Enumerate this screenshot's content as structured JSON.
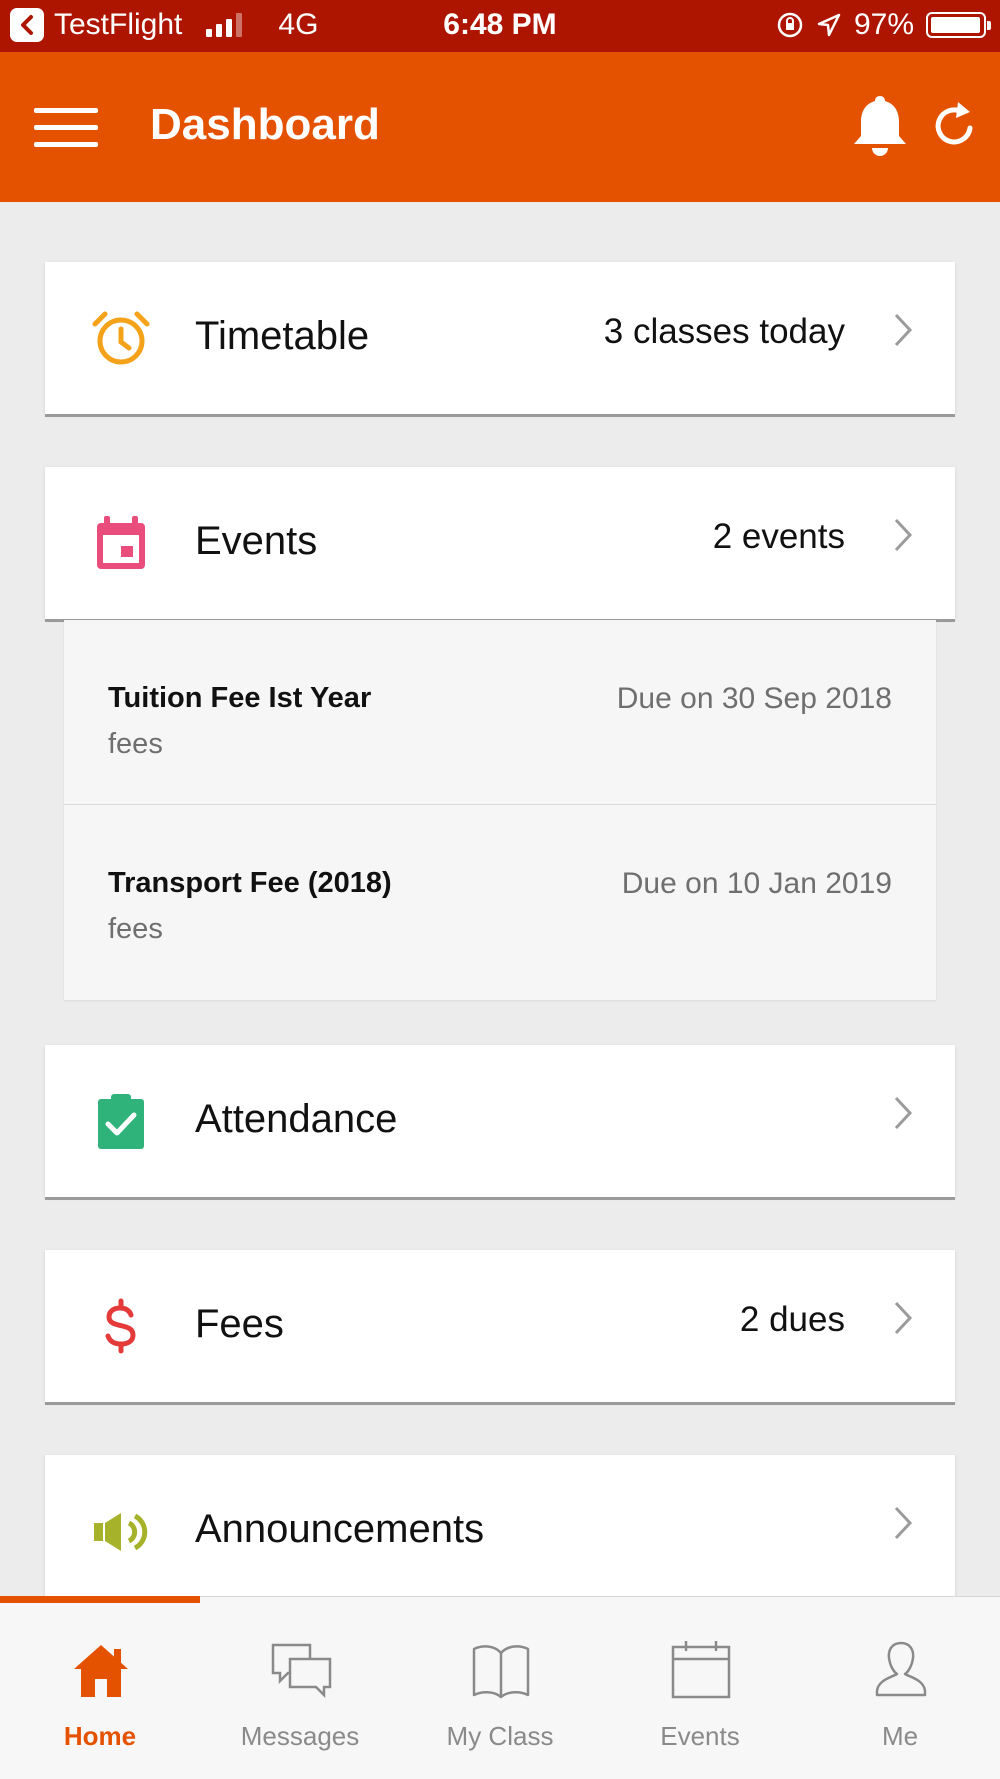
{
  "status_bar": {
    "back_app": "TestFlight",
    "network": "4G",
    "time": "6:48 PM",
    "battery": "97%",
    "battery_level": 0.97
  },
  "header": {
    "title": "Dashboard",
    "icons": [
      "menu-icon",
      "bell-icon",
      "refresh-icon"
    ]
  },
  "cards": {
    "timetable": {
      "label": "Timetable",
      "meta": "3 classes today",
      "icon": "alarm-clock-icon",
      "color": "#f3a21a"
    },
    "events": {
      "label": "Events",
      "meta": "2 events",
      "icon": "calendar-icon",
      "color": "#e84d7c"
    },
    "attendance": {
      "label": "Attendance",
      "meta": "",
      "icon": "clipboard-check-icon",
      "color": "#2fb37a"
    },
    "fees": {
      "label": "Fees",
      "meta": "2 dues",
      "icon": "dollar-icon",
      "color": "#e43a3a"
    },
    "announcements": {
      "label": "Announcements",
      "meta": "",
      "icon": "megaphone-icon",
      "color": "#a5b22a"
    }
  },
  "fees_due": [
    {
      "name": "Tuition Fee Ist Year",
      "type": "fees",
      "due": "Due on 30 Sep 2018"
    },
    {
      "name": "Transport Fee (2018)",
      "type": "fees",
      "due": "Due on 10 Jan 2019"
    }
  ],
  "tabs": [
    {
      "label": "Home",
      "icon": "home-icon",
      "active": true
    },
    {
      "label": "Messages",
      "icon": "messages-icon",
      "active": false
    },
    {
      "label": "My Class",
      "icon": "book-icon",
      "active": false
    },
    {
      "label": "Events",
      "icon": "calendar-icon",
      "active": false
    },
    {
      "label": "Me",
      "icon": "person-icon",
      "active": false
    }
  ],
  "colors": {
    "primary": "#e45200",
    "status_bar": "#ad1500",
    "background": "#ececec"
  }
}
